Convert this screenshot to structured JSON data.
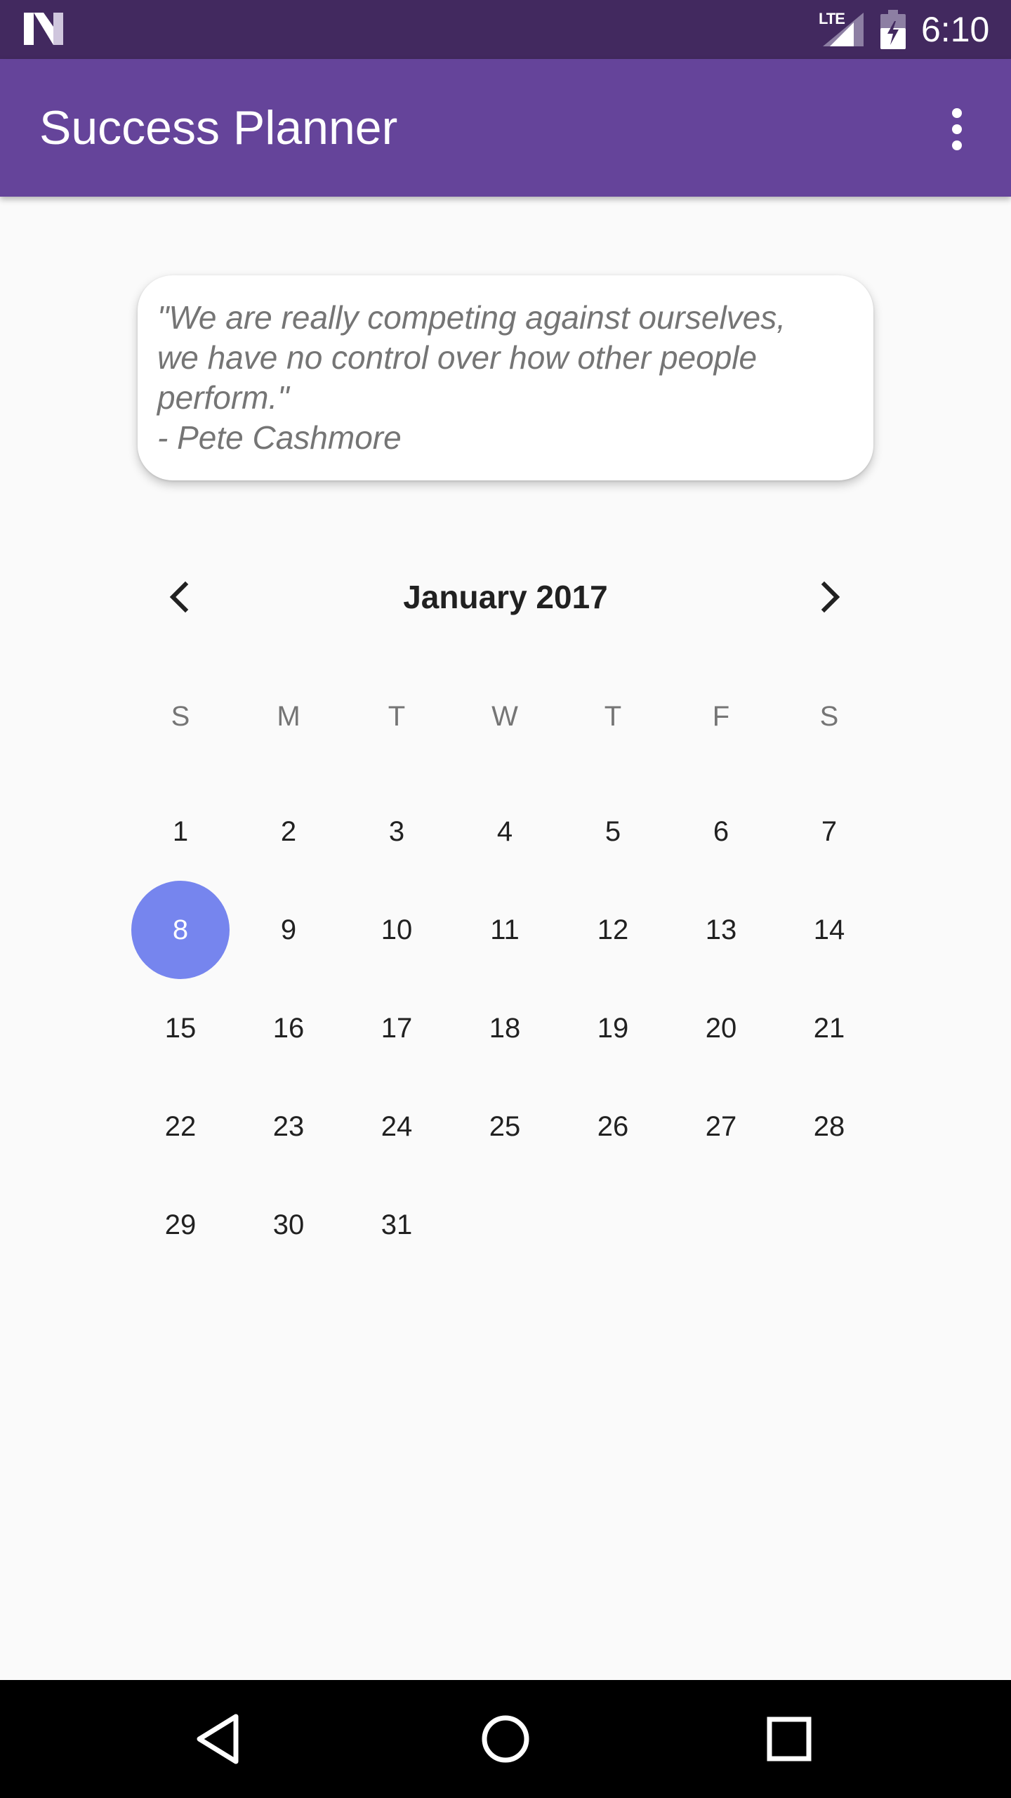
{
  "status_bar": {
    "network_label": "LTE",
    "time": "6:10",
    "icons": [
      "n-logo-icon",
      "signal-icon",
      "battery-icon"
    ]
  },
  "app_bar": {
    "title": "Success Planner",
    "menu_icon": "overflow-menu-icon"
  },
  "quote": {
    "text": "\"We are really competing against ourselves,\nwe have no control over how other people\nperform.\"\n- Pete Cashmore"
  },
  "calendar": {
    "month_label": "January 2017",
    "prev_icon": "chevron-left-icon",
    "next_icon": "chevron-right-icon",
    "weekdays": [
      "S",
      "M",
      "T",
      "W",
      "T",
      "F",
      "S"
    ],
    "first_day_column": 0,
    "days": [
      "1",
      "2",
      "3",
      "4",
      "5",
      "6",
      "7",
      "8",
      "9",
      "10",
      "11",
      "12",
      "13",
      "14",
      "15",
      "16",
      "17",
      "18",
      "19",
      "20",
      "21",
      "22",
      "23",
      "24",
      "25",
      "26",
      "27",
      "28",
      "29",
      "30",
      "31"
    ],
    "selected_day": "8",
    "selected_color": "#7685ee"
  },
  "nav_bar": {
    "icons": [
      "back-icon",
      "home-icon",
      "recents-icon"
    ]
  },
  "colors": {
    "status_bar": "#42295f",
    "app_bar": "#65449a",
    "background": "#fafafa",
    "nav_bar": "#000000"
  }
}
